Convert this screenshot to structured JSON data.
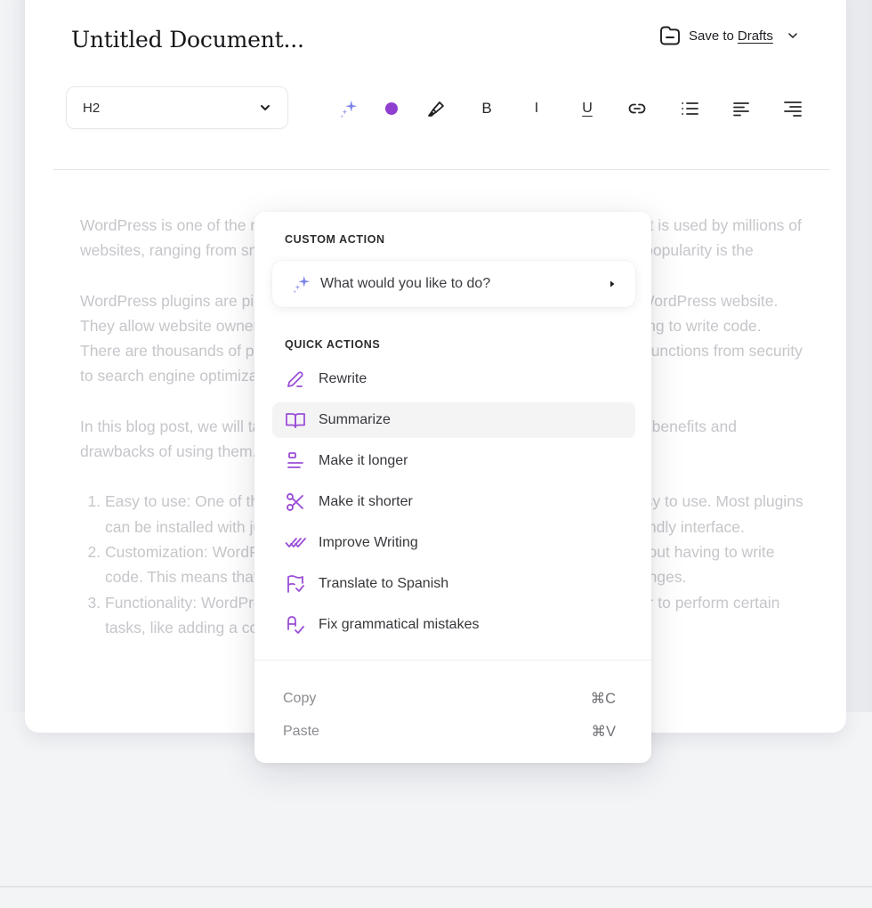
{
  "document": {
    "title": "Untitled Document...",
    "save": {
      "prefix": "Save to",
      "target": "Drafts"
    }
  },
  "toolbar": {
    "heading_select": "H2",
    "tools": [
      {
        "name": "ai-sparkle",
        "label": ""
      },
      {
        "name": "text-color",
        "label": "",
        "color": "#8e3fd0"
      },
      {
        "name": "highlighter",
        "label": ""
      },
      {
        "name": "bold",
        "label": "B"
      },
      {
        "name": "italic",
        "label": "I"
      },
      {
        "name": "underline",
        "label": "U"
      },
      {
        "name": "link",
        "label": ""
      },
      {
        "name": "bullet-list",
        "label": ""
      },
      {
        "name": "align-left",
        "label": ""
      },
      {
        "name": "align-right",
        "label": ""
      }
    ]
  },
  "content": {
    "paragraphs": [
      "WordPress is one of the most popular content management systems in the world. It is used by millions of websites, ranging from small blogs to large enterprises. One of the reasons for its popularity is the",
      "WordPress plugins are pieces of software that add features and functionality to a WordPress website. They allow website owners and developers to customize their website without having to write code. There are thousands of plugins available for WordPress, covering a wide range of functions from security to search engine optimization (SEO).",
      "In this blog post, we will take a look at WordPress plugins and discuss some of the benefits and drawbacks of using them."
    ],
    "list": [
      "Easy to use: One of the main benefits of WordPress plugins is that they are easy to use. Most plugins can be installed with just a few clicks and can be configured through a user-friendly interface.",
      "Customization: WordPress plugins allow users to customize their websites without having to write code. This means that even those with little technical knowledge can make changes.",
      "Functionality: WordPress plugins add functionality to a website, making it easier to perform certain tasks, like adding a contact form to a website or"
    ]
  },
  "context_menu": {
    "custom_action": {
      "label": "CUSTOM ACTION",
      "placeholder": "What would you like to do?"
    },
    "quick_actions": {
      "label": "QUICK ACTIONS",
      "items": [
        {
          "label": "Rewrite",
          "icon": "pencil-icon"
        },
        {
          "label": "Summarize",
          "icon": "book-open-icon",
          "hovered": true
        },
        {
          "label": "Make it longer",
          "icon": "text-expand-icon"
        },
        {
          "label": "Make it shorter",
          "icon": "scissors-icon"
        },
        {
          "label": "Improve Writing",
          "icon": "double-check-icon"
        },
        {
          "label": "Translate to Spanish",
          "icon": "translate-flag-icon"
        },
        {
          "label": "Fix grammatical mistakes",
          "icon": "spell-check-icon"
        }
      ]
    },
    "clipboard": [
      {
        "label": "Copy",
        "shortcut": "⌘C"
      },
      {
        "label": "Paste",
        "shortcut": "⌘V"
      }
    ]
  },
  "colors": {
    "accent_purple": "#9b4fd6",
    "sparkle_blue": "#7b83e8"
  }
}
